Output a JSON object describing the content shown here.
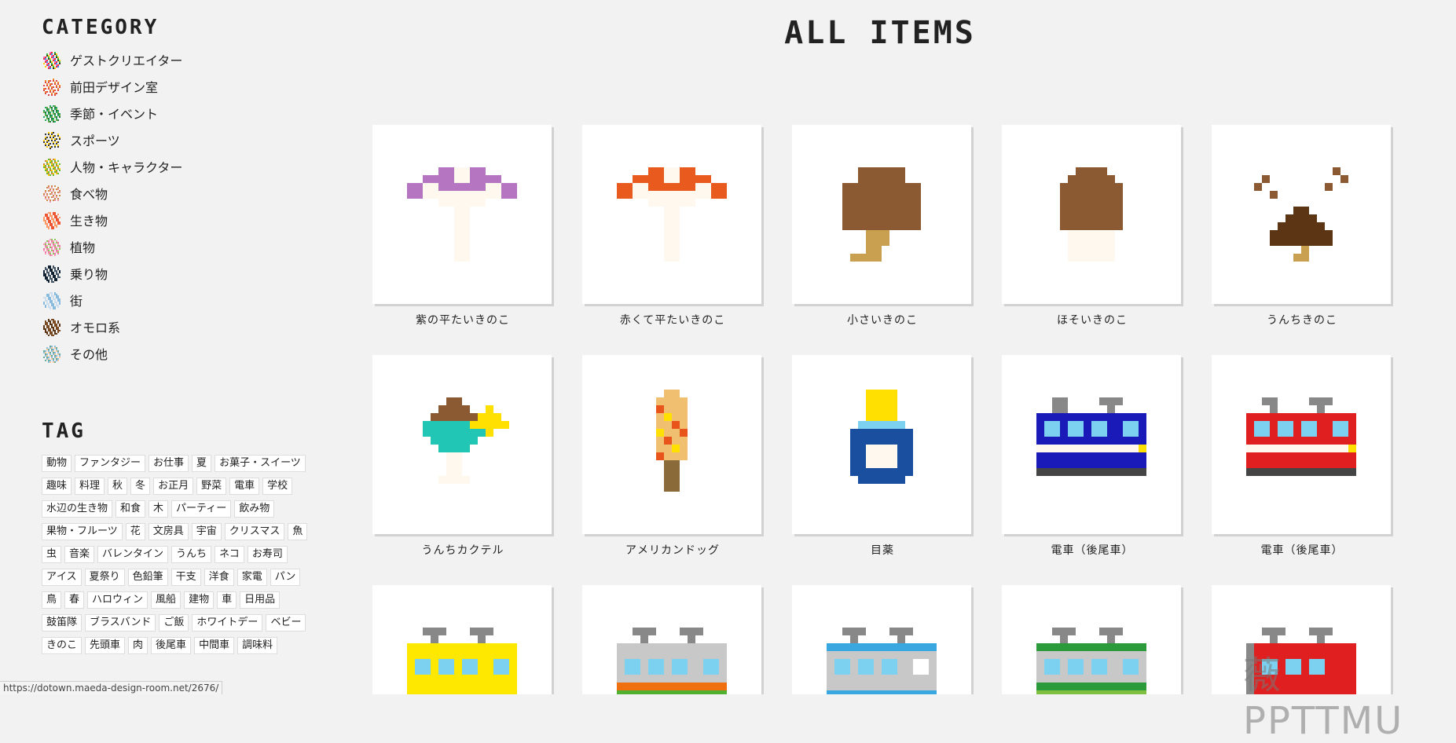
{
  "sidebar": {
    "category_title": "CATEGORY",
    "categories": [
      {
        "label": "ゲストクリエイター",
        "icon": "guest-creator-icon"
      },
      {
        "label": "前田デザイン室",
        "icon": "maeda-design-icon"
      },
      {
        "label": "季節・イベント",
        "icon": "tree-icon"
      },
      {
        "label": "スポーツ",
        "icon": "sports-icon"
      },
      {
        "label": "人物・キャラクター",
        "icon": "person-icon"
      },
      {
        "label": "食べ物",
        "icon": "food-icon"
      },
      {
        "label": "生き物",
        "icon": "crab-icon"
      },
      {
        "label": "植物",
        "icon": "flower-icon"
      },
      {
        "label": "乗り物",
        "icon": "car-icon"
      },
      {
        "label": "街",
        "icon": "building-icon"
      },
      {
        "label": "オモロ系",
        "icon": "poop-icon"
      },
      {
        "label": "その他",
        "icon": "picture-icon"
      }
    ],
    "tag_title": "TAG",
    "tags": [
      "動物",
      "ファンタジー",
      "お仕事",
      "夏",
      "お菓子・スイーツ",
      "趣味",
      "料理",
      "秋",
      "冬",
      "お正月",
      "野菜",
      "電車",
      "学校",
      "水辺の生き物",
      "和食",
      "木",
      "パーティー",
      "飲み物",
      "果物・フルーツ",
      "花",
      "文房具",
      "宇宙",
      "クリスマス",
      "魚",
      "虫",
      "音楽",
      "バレンタイン",
      "うんち",
      "ネコ",
      "お寿司",
      "アイス",
      "夏祭り",
      "色鉛筆",
      "干支",
      "洋食",
      "家電",
      "パン",
      "鳥",
      "春",
      "ハロウィン",
      "風船",
      "建物",
      "車",
      "日用品",
      "鼓笛隊",
      "ブラスバンド",
      "ご飯",
      "ホワイトデー",
      "ベビー",
      "きのこ",
      "先頭車",
      "肉",
      "後尾車",
      "中間車",
      "調味料"
    ]
  },
  "main": {
    "title": "ALL ITEMS",
    "items": [
      {
        "caption": "紫の平たいきのこ",
        "icon": "purple-flat-mushroom-icon"
      },
      {
        "caption": "赤くて平たいきのこ",
        "icon": "red-flat-mushroom-icon"
      },
      {
        "caption": "小さいきのこ",
        "icon": "small-mushroom-icon"
      },
      {
        "caption": "ほそいきのこ",
        "icon": "thin-mushroom-icon"
      },
      {
        "caption": "うんちきのこ",
        "icon": "poop-mushroom-icon"
      },
      {
        "caption": "うんちカクテル",
        "icon": "poop-cocktail-icon"
      },
      {
        "caption": "アメリカンドッグ",
        "icon": "corn-dog-icon"
      },
      {
        "caption": "目薬",
        "icon": "eye-drops-icon"
      },
      {
        "caption": "電車（後尾車）",
        "icon": "blue-train-rear-icon"
      },
      {
        "caption": "電車（後尾車）",
        "icon": "red-train-rear-icon"
      },
      {
        "caption": "",
        "icon": "yellow-train-icon"
      },
      {
        "caption": "",
        "icon": "gray-train-icon"
      },
      {
        "caption": "",
        "icon": "skyblue-train-icon"
      },
      {
        "caption": "",
        "icon": "green-train-icon"
      },
      {
        "caption": "",
        "icon": "red-train-icon"
      }
    ]
  },
  "statusbar": {
    "url": "https://dotown.maeda-design-room.net/2676/"
  },
  "watermark": {
    "text": "薇 PPTTMU"
  },
  "colors": {
    "background": "#f2f2f2",
    "tile": "#ffffff"
  }
}
